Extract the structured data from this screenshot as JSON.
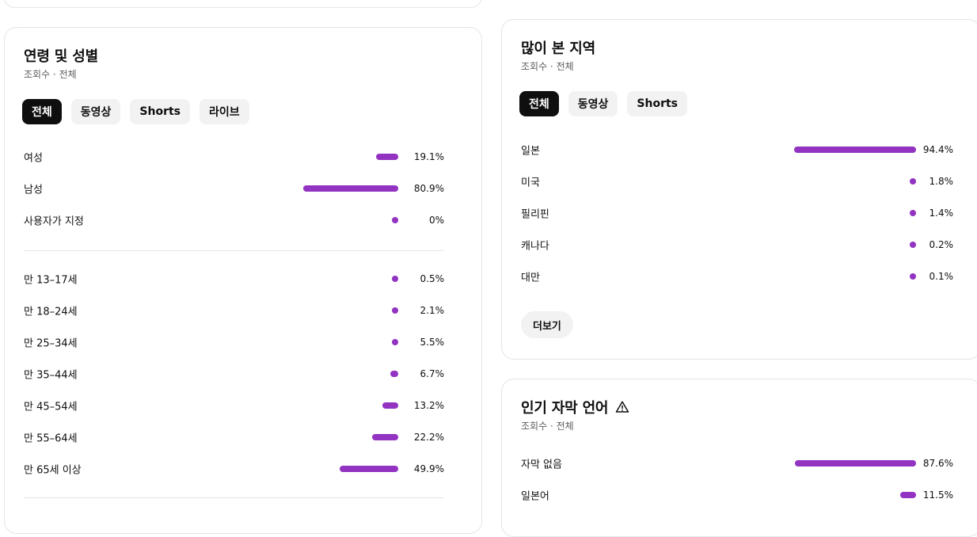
{
  "age_gender": {
    "title": "연령 및 성별",
    "subtitle": "조회수 · 전체",
    "tabs": [
      {
        "label": "전체",
        "active": true
      },
      {
        "label": "동영상",
        "active": false
      },
      {
        "label": "Shorts",
        "active": false
      },
      {
        "label": "라이브",
        "active": false
      }
    ],
    "gender_rows": [
      {
        "label": "여성",
        "value": 19.1,
        "display": "19.1%"
      },
      {
        "label": "남성",
        "value": 80.9,
        "display": "80.9%"
      },
      {
        "label": "사용자가 지정",
        "value": 0,
        "display": "0%"
      }
    ],
    "age_rows": [
      {
        "label": "만 13–17세",
        "value": 0.5,
        "display": "0.5%"
      },
      {
        "label": "만 18–24세",
        "value": 2.1,
        "display": "2.1%"
      },
      {
        "label": "만 25–34세",
        "value": 5.5,
        "display": "5.5%"
      },
      {
        "label": "만 35–44세",
        "value": 6.7,
        "display": "6.7%"
      },
      {
        "label": "만 45–54세",
        "value": 13.2,
        "display": "13.2%"
      },
      {
        "label": "만 55–64세",
        "value": 22.2,
        "display": "22.2%"
      },
      {
        "label": "만 65세 이상",
        "value": 49.9,
        "display": "49.9%"
      }
    ]
  },
  "geography": {
    "title": "많이 본 지역",
    "subtitle": "조회수 · 전체",
    "tabs": [
      {
        "label": "전체",
        "active": true
      },
      {
        "label": "동영상",
        "active": false
      },
      {
        "label": "Shorts",
        "active": false
      }
    ],
    "rows": [
      {
        "label": "일본",
        "value": 94.4,
        "display": "94.4%"
      },
      {
        "label": "미국",
        "value": 1.8,
        "display": "1.8%"
      },
      {
        "label": "필리핀",
        "value": 1.4,
        "display": "1.4%"
      },
      {
        "label": "캐나다",
        "value": 0.2,
        "display": "0.2%"
      },
      {
        "label": "대만",
        "value": 0.1,
        "display": "0.1%"
      }
    ],
    "more_label": "더보기"
  },
  "subtitle_languages": {
    "title": "인기 자막 언어",
    "subtitle": "조회수 · 전체",
    "warning_icon": "warning-icon",
    "rows": [
      {
        "label": "자막 없음",
        "value": 87.6,
        "display": "87.6%"
      },
      {
        "label": "일본어",
        "value": 11.5,
        "display": "11.5%"
      }
    ]
  },
  "colors": {
    "bar": "#9233c1",
    "chip_active_bg": "#0f0f0f",
    "chip_bg": "#f2f2f2"
  }
}
